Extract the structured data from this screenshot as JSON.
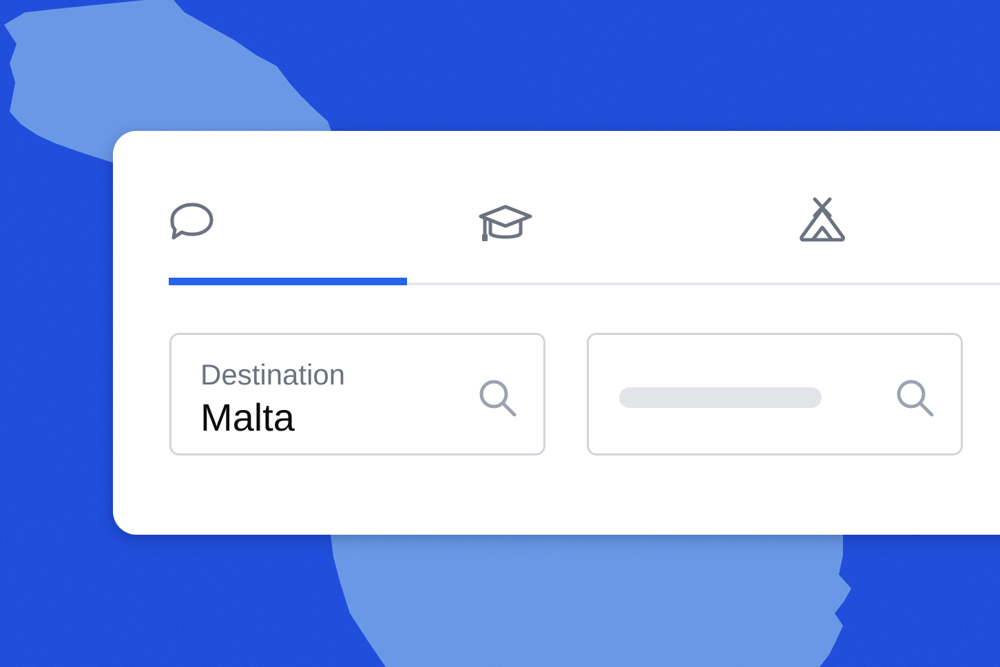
{
  "theme": {
    "background": "#0d3fd8",
    "island": "#5d8fe4",
    "card": "#ffffff",
    "accent": "#2563eb",
    "icon": "#6b7280",
    "border": "#d2d5da"
  },
  "tabs": [
    {
      "icon": "chat-bubble-icon",
      "selected": true
    },
    {
      "icon": "graduation-cap-icon",
      "selected": false
    },
    {
      "icon": "tent-icon",
      "selected": false
    }
  ],
  "search": {
    "destination": {
      "label": "Destination",
      "value": "Malta",
      "icon": "search-icon"
    },
    "secondary": {
      "label": "",
      "value": "",
      "icon": "search-icon"
    }
  }
}
